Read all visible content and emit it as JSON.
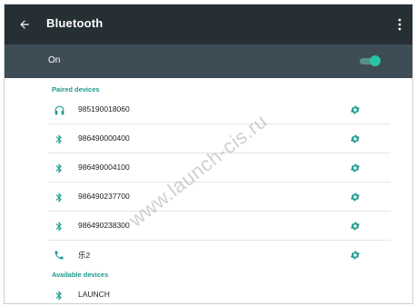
{
  "app_bar": {
    "title": "Bluetooth",
    "back_icon": "arrow-left-icon",
    "more_icon": "more-vert-icon"
  },
  "toggle": {
    "label": "On",
    "state": "on"
  },
  "colors": {
    "app_bar_bg": "#262f34",
    "toggle_bar_bg": "#3e4d55",
    "accent": "#1a9a8c",
    "switch_thumb": "#2ac3a5"
  },
  "paired": {
    "header": "Paired devices",
    "devices": [
      {
        "name": "985190018060",
        "icon": "headphones-icon"
      },
      {
        "name": "986490000400",
        "icon": "bluetooth-icon"
      },
      {
        "name": "986490004100",
        "icon": "bluetooth-icon"
      },
      {
        "name": "986490237700",
        "icon": "bluetooth-icon"
      },
      {
        "name": "986490238300",
        "icon": "bluetooth-icon"
      },
      {
        "name": "乐2",
        "icon": "phone-icon"
      }
    ]
  },
  "available": {
    "header": "Available devices",
    "devices": [
      {
        "name": "LAUNCH",
        "icon": "bluetooth-icon"
      }
    ]
  },
  "watermark": "www.launch-cis.ru"
}
